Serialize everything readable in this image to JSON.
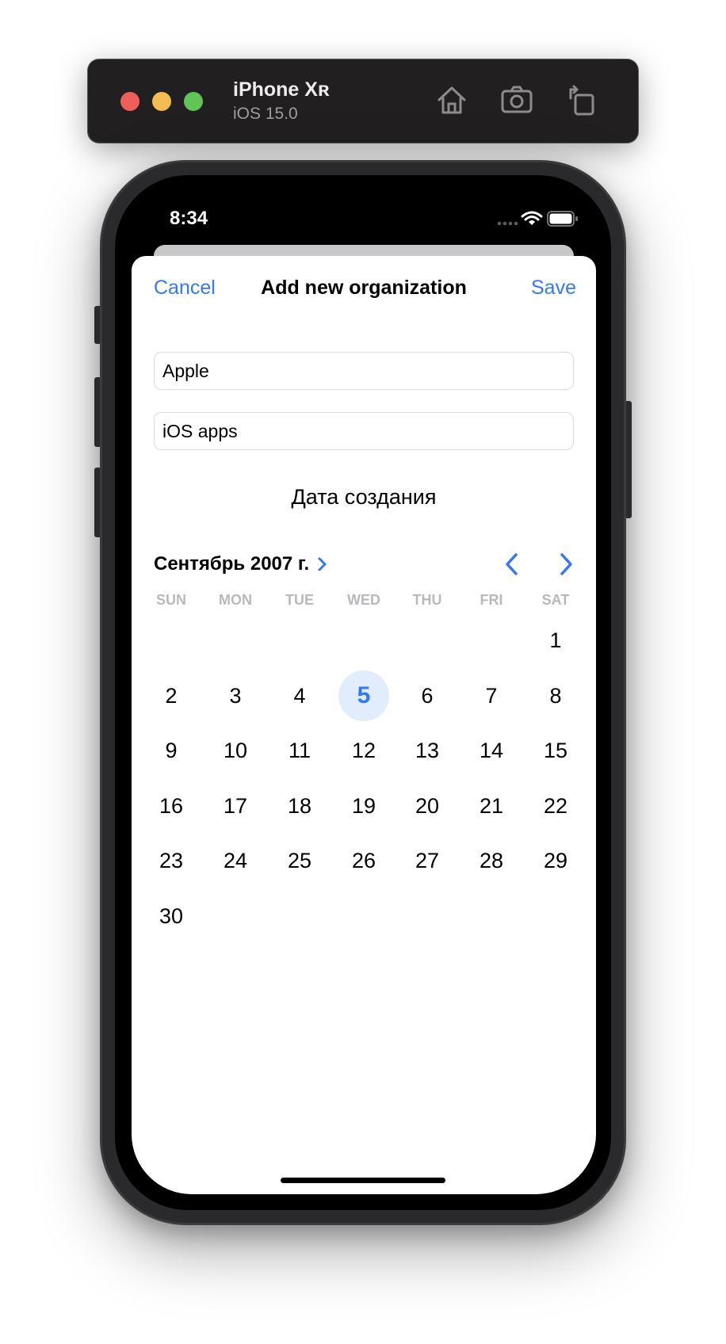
{
  "simulator": {
    "device_name": "iPhone Xʀ",
    "os_version": "iOS 15.0",
    "icons": [
      "home-icon",
      "screenshot-icon",
      "rotate-icon"
    ]
  },
  "status_bar": {
    "time": "8:34"
  },
  "nav": {
    "cancel": "Cancel",
    "title": "Add new organization",
    "save": "Save"
  },
  "form": {
    "name_value": "Apple",
    "description_value": "iOS apps",
    "date_label": "Дата создания"
  },
  "calendar": {
    "month_label": "Сентябрь 2007 г.",
    "weekdays": [
      "SUN",
      "MON",
      "TUE",
      "WED",
      "THU",
      "FRI",
      "SAT"
    ],
    "first_weekday_index": 6,
    "days_in_month": 30,
    "selected_day": 5
  },
  "colors": {
    "accent": "#3478f6",
    "selected_bg": "#e1edfd",
    "weekday_text": "#b9b9bd"
  }
}
